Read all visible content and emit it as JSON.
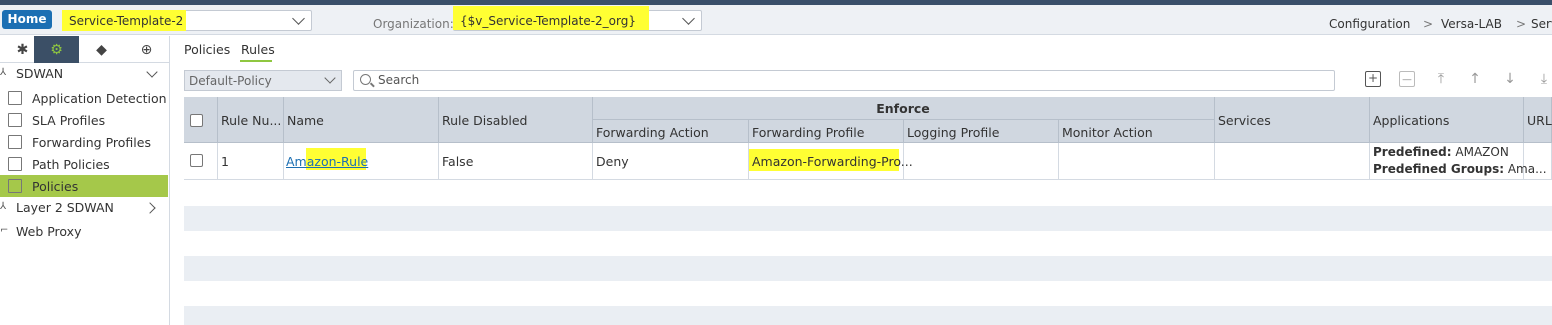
{
  "topbar": {
    "home_label": "Home",
    "template_value": "Service-Template-2",
    "organization_label": "Organization:",
    "organization_value": "{$v_Service-Template-2_org}",
    "breadcrumb": [
      "Configuration",
      "Versa-LAB",
      "Serv"
    ],
    "breadcrumb_sep": ">"
  },
  "sidebar": {
    "tabs": [
      "network-icon",
      "gear-icon",
      "cube-icon",
      "globe-gear-icon"
    ],
    "items": [
      {
        "label": "SDWAN",
        "icon": "tree-icon"
      },
      {
        "label": "Application Detection",
        "icon": "document-icon"
      },
      {
        "label": "SLA Profiles",
        "icon": "sla-icon"
      },
      {
        "label": "Forwarding Profiles",
        "icon": "list-icon"
      },
      {
        "label": "Path Policies",
        "icon": "policy-icon"
      },
      {
        "label": "Policies",
        "icon": "policy-icon"
      },
      {
        "label": "Layer 2 SDWAN",
        "icon": "tree-icon"
      },
      {
        "label": "Web Proxy",
        "icon": "proxy-icon"
      }
    ]
  },
  "content": {
    "tabs": [
      "Policies",
      "Rules"
    ],
    "active_tab": "Rules",
    "policy_select": "Default-Policy",
    "search_placeholder": "Search",
    "toolbar": [
      "add",
      "remove",
      "move-top",
      "move-up",
      "move-down",
      "move-bottom"
    ]
  },
  "table": {
    "headers": {
      "rule_num": "Rule Nu...",
      "name": "Name",
      "rule_disabled": "Rule Disabled",
      "enforce": "Enforce",
      "forwarding_action": "Forwarding Action",
      "forwarding_profile": "Forwarding Profile",
      "logging_profile": "Logging Profile",
      "monitor_action": "Monitor Action",
      "services": "Services",
      "applications": "Applications",
      "url": "URL"
    },
    "rows": [
      {
        "rule_num": "1",
        "name": "Amazon-Rule",
        "rule_disabled": "False",
        "forwarding_action": "Deny",
        "forwarding_profile": "Amazon-Forwarding-Pro...",
        "logging_profile": "",
        "monitor_action": "",
        "services": "",
        "app_predefined_label": "Predefined:",
        "app_predefined_value": "AMAZON",
        "app_groups_label": "Predefined Groups:",
        "app_groups_value": "Ama..."
      }
    ]
  },
  "colors": {
    "accent_green": "#8fc740",
    "home_blue": "#1c6fb3",
    "highlight_yellow": "#ffff33",
    "active_nav": "#a5c84a"
  }
}
